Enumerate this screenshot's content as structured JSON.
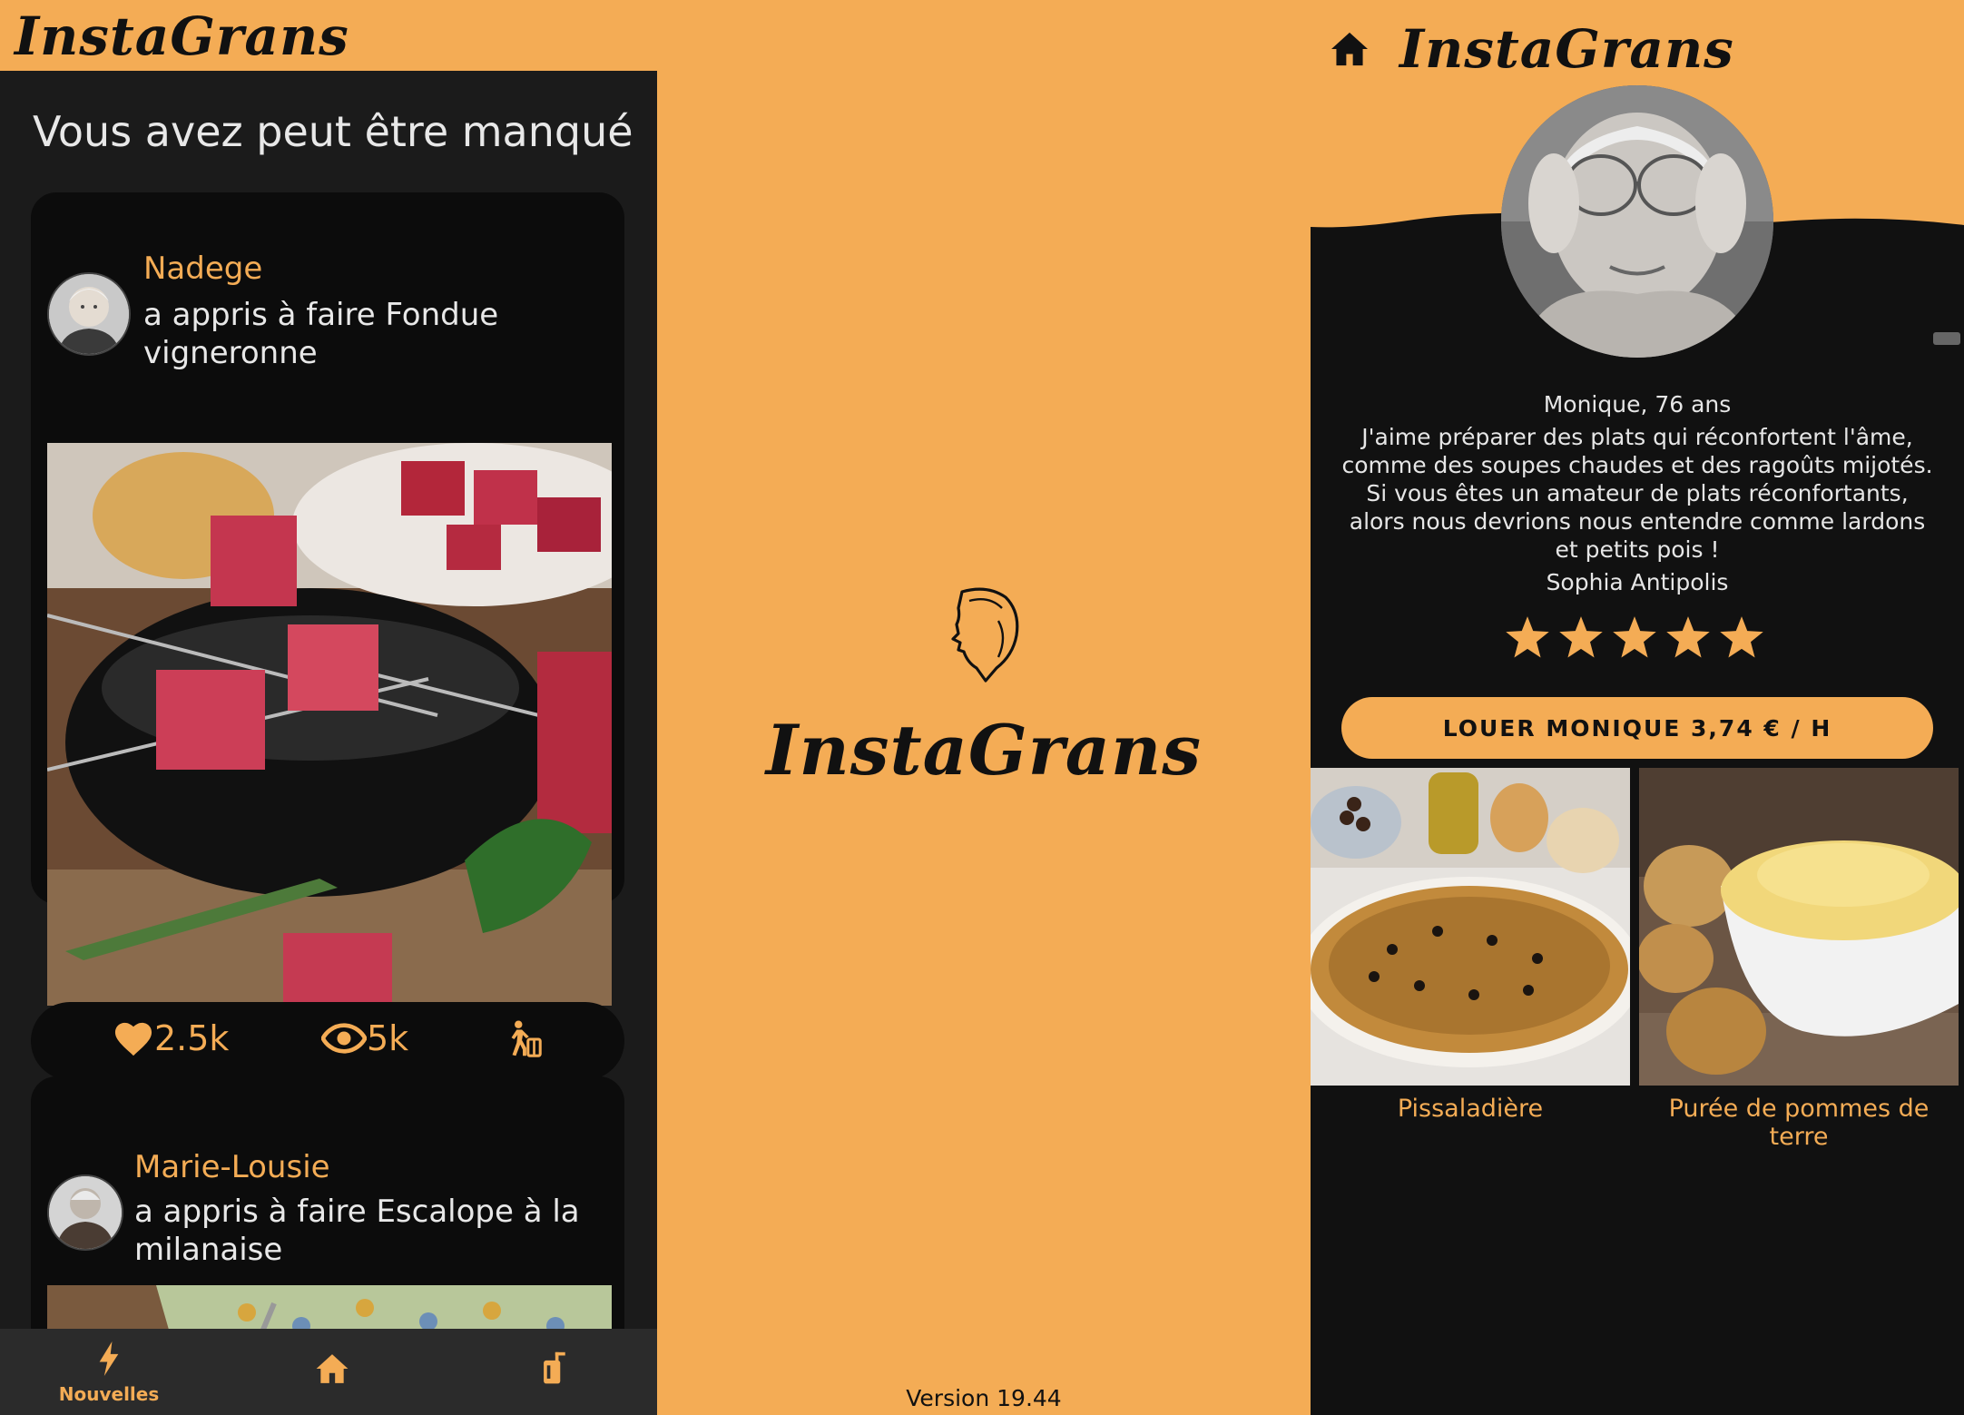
{
  "colors": {
    "accent": "#F4AC55",
    "dark": "#111111",
    "card": "#0c0c0c"
  },
  "feed_screen": {
    "app_title": "InstaGrans",
    "section_title": "Vous avez peut être manqué",
    "posts": [
      {
        "user": "Nadege",
        "activity": "a appris à faire Fondue vigneronne"
      },
      {
        "user": "Marie-Lousie",
        "activity": "a appris à faire Escalope à la milanaise"
      }
    ],
    "stats": {
      "likes": "2.5k",
      "views": "5k"
    },
    "nav": {
      "news_label": "Nouvelles",
      "icons": [
        "lightning-icon",
        "home-icon",
        "luggage-icon"
      ]
    }
  },
  "splash_screen": {
    "title": "InstaGrans",
    "version": "Version 19.44"
  },
  "profile_screen": {
    "app_title": "InstaGrans",
    "name_age": "Monique, 76 ans",
    "bio": "J'aime préparer des plats qui réconfortent l'âme, comme des soupes chaudes et des ragoûts mijotés. Si vous êtes un amateur de plats réconfortants, alors nous devrions nous entendre comme lardons et petits pois !",
    "location": "Sophia Antipolis",
    "rating": 5,
    "rent_button": "LOUER MONIQUE 3,74 € / H",
    "dishes": [
      {
        "name": "Pissaladière"
      },
      {
        "name": "Purée de pommes de terre"
      }
    ]
  }
}
